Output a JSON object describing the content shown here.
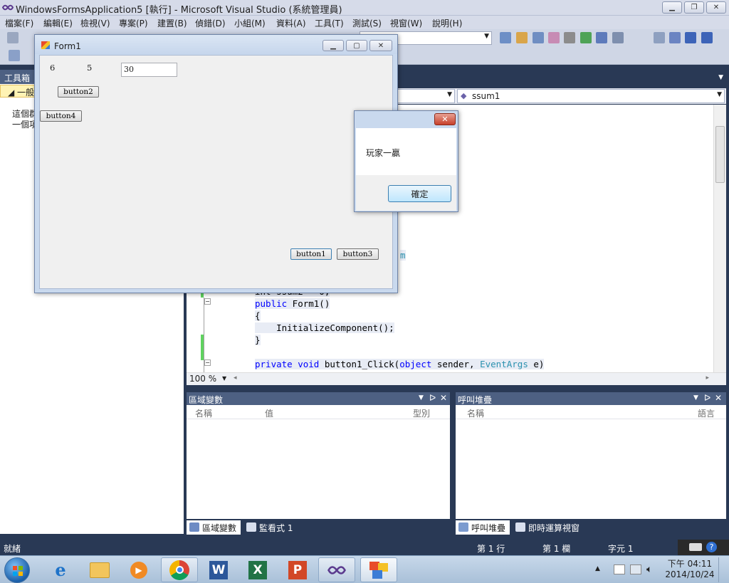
{
  "vs": {
    "title": "WindowsFormsApplication5 [執行] - Microsoft Visual Studio (系統管理員)",
    "menu": [
      "檔案(F)",
      "編輯(E)",
      "檢視(V)",
      "專案(P)",
      "建置(B)",
      "偵錯(D)",
      "小組(M)",
      "資料(A)",
      "工具(T)",
      "測試(S)",
      "視窗(W)",
      "說明(H)"
    ]
  },
  "toolbox": {
    "title": "工具箱",
    "section": "◢ 一般",
    "empty_text_line1": "這個群",
    "empty_text_line2": "一個項"
  },
  "editor": {
    "member_combo": "ssum1",
    "code_fragment_m": "m",
    "code": {
      "line_int": "int ssum2 = 0;",
      "line_ctor_kw": "public",
      "line_ctor_rest": " Form1()",
      "line_open": "{",
      "line_init": "    InitializeComponent();",
      "line_close": "}",
      "line_handler_kw1": "private",
      "line_handler_kw2": "void",
      "line_handler_name": " button1_Click(",
      "line_handler_kw3": "object",
      "line_handler_mid": " sender, ",
      "line_handler_type": "EventArgs",
      "line_handler_end": " e)"
    },
    "zoom": "100 %"
  },
  "locals_panel": {
    "title": "區域變數",
    "columns": [
      "名稱",
      "值",
      "型別"
    ],
    "tabs": [
      "區域變數",
      "監看式 1"
    ]
  },
  "callstack_panel": {
    "title": "呼叫堆疊",
    "columns": [
      "名稱",
      "語言"
    ],
    "tabs": [
      "呼叫堆疊",
      "即時運算視窗"
    ]
  },
  "status": {
    "ready": "就緒",
    "line": "第 1 行",
    "col": "第 1 欄",
    "char": "字元 1"
  },
  "form1": {
    "title": "Form1",
    "label1": "6",
    "label2": "5",
    "textbox": "30",
    "button2": "button2",
    "button4": "button4",
    "button1": "button1",
    "button3": "button3"
  },
  "msgbox": {
    "message": "玩家一贏",
    "ok": "確定",
    "close_glyph": "✕"
  },
  "taskbar": {
    "time": "下午 04:11",
    "date": "2014/10/24"
  },
  "colors": {
    "vs_dark": "#293955",
    "panel_header": "#4d6082",
    "keyword": "#0000ff",
    "type": "#2b91af"
  }
}
